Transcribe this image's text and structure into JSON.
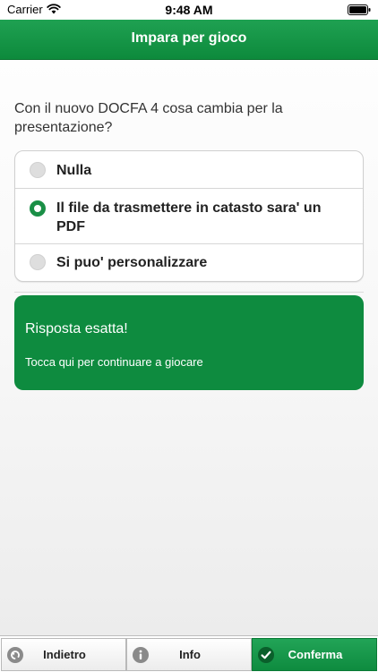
{
  "status_bar": {
    "carrier": "Carrier",
    "time": "9:48 AM"
  },
  "header": {
    "title": "Impara per gioco"
  },
  "quiz": {
    "question": "Con il nuovo DOCFA 4 cosa cambia per la presentazione?",
    "options": [
      {
        "label": "Nulla",
        "selected": false
      },
      {
        "label": "Il file da trasmettere in catasto sara' un PDF",
        "selected": true
      },
      {
        "label": "Si puo' personalizzare",
        "selected": false
      }
    ]
  },
  "result": {
    "title": "Risposta esatta!",
    "subtitle": "Tocca qui per continuare a giocare"
  },
  "toolbar": {
    "back_label": "Indietro",
    "info_label": "Info",
    "confirm_label": "Conferma"
  },
  "colors": {
    "brand_green": "#0e8b3f",
    "nav_gradient_top": "#1fa152",
    "text_dark": "#222222"
  },
  "icons": {
    "back": "undo-arrow-icon",
    "info": "info-icon",
    "confirm": "check-icon",
    "wifi": "wifi-icon",
    "battery": "battery-icon"
  }
}
